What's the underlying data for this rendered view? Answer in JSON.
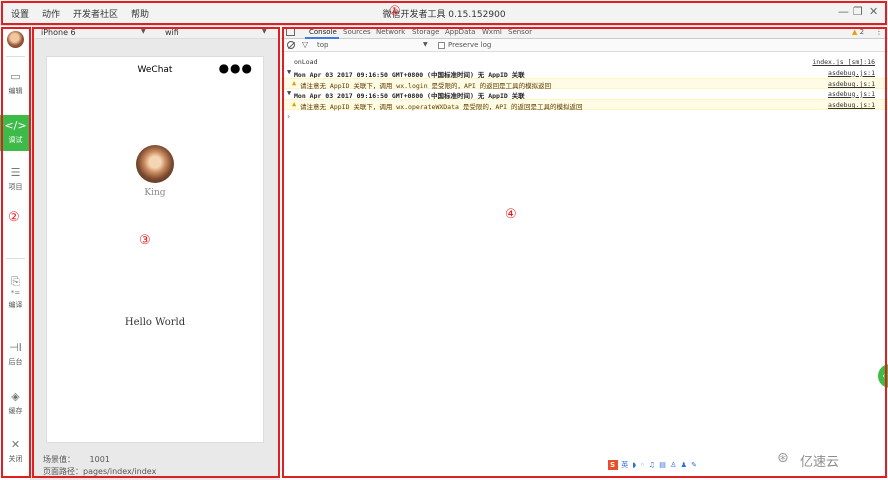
{
  "menu": [
    "设置",
    "动作",
    "开发者社区",
    "帮助"
  ],
  "app_title": "微信开发者工具 0.15.152900",
  "window_controls": {
    "minimize": "—",
    "restore": "❐",
    "close": "✕"
  },
  "markers": [
    "①",
    "②",
    "③",
    "④"
  ],
  "toolbar": {
    "items": [
      {
        "label": "编辑",
        "icon": "edit-icon",
        "glyph": "▭"
      },
      {
        "label": "调试",
        "icon": "code-icon",
        "glyph": "</>"
      },
      {
        "label": "项目",
        "icon": "menu-icon",
        "glyph": "☰"
      },
      {
        "label": "编译",
        "icon": "compile-icon",
        "glyph": "⎘"
      },
      {
        "label": "后台",
        "icon": "background-icon",
        "glyph": "⊣I"
      },
      {
        "label": "缓存",
        "icon": "layers-icon",
        "glyph": "◈"
      },
      {
        "label": "关闭",
        "icon": "close-icon",
        "glyph": "✕"
      }
    ],
    "compile_mode_glyph": "*="
  },
  "simulator": {
    "device": "iPhone 6",
    "network": "wifi",
    "nav_title": "WeChat",
    "nav_dots": "●●●",
    "user_name": "King",
    "hello": "Hello World",
    "scene_label": "场景值：",
    "scene_value": "1001",
    "path_label": "页面路径：",
    "path_value": "pages/index/index"
  },
  "devtools": {
    "tabs": [
      "Console",
      "Sources",
      "Network",
      "Storage",
      "AppData",
      "Wxml",
      "Sensor"
    ],
    "warn_count": "2",
    "filter_context": "top",
    "preserve_log": "Preserve log",
    "console_rows": [
      {
        "type": "log",
        "text": "onLoad",
        "source": "index.js [sm]:16"
      },
      {
        "type": "group",
        "text": "Mon Apr 03 2017 09:16:50 GMT+0800 (中国标准时间) 无 AppID 关联",
        "source": "asdebug.js:1"
      },
      {
        "type": "warn",
        "text": "请注意无 AppID 关联下，调用 wx.login 是受限的，API 的返回是工具的模拟返回",
        "source": "asdebug.js:1"
      },
      {
        "type": "group",
        "text": "Mon Apr 03 2017 09:16:50 GMT+0800 (中国标准时间) 无 AppID 关联",
        "source": "asdebug.js:1"
      },
      {
        "type": "warn",
        "text": "请注意无 AppID 关联下，调用 wx.operateWXData 是受限的，API 的返回是工具的模拟返回",
        "source": "asdebug.js:1"
      }
    ],
    "prompt": "›"
  },
  "ime_bar": {
    "s": "S",
    "rest": "英 ◗ ◦ ♫ ▤ ♙ ♟ ✎"
  },
  "watermark": "亿速云",
  "side_handle": "‹‹"
}
